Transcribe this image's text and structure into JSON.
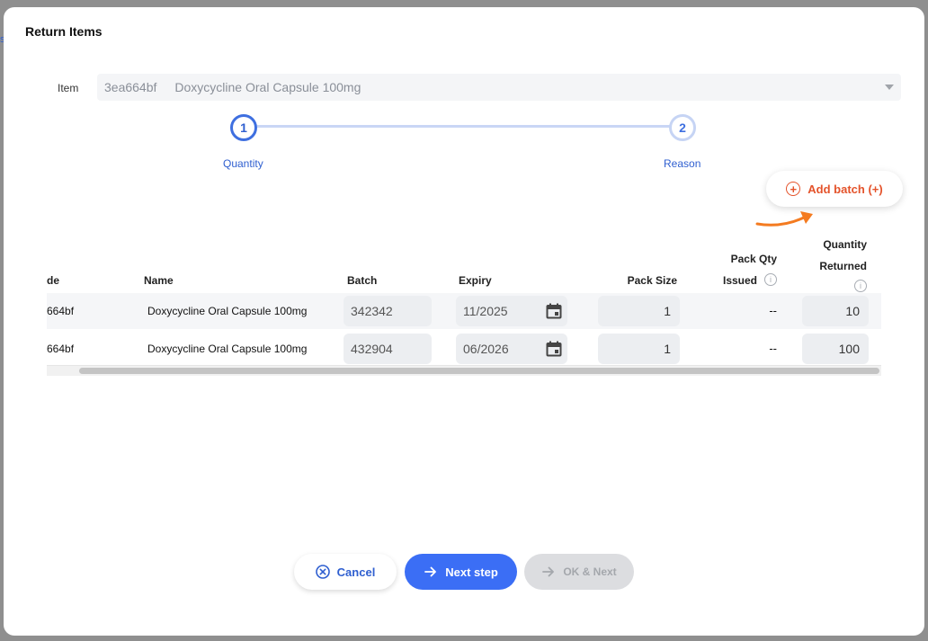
{
  "backdrop": {
    "hint_char": "s"
  },
  "modal": {
    "title": "Return Items"
  },
  "item_field": {
    "label": "Item",
    "code": "3ea664bf",
    "name": "Doxycycline Oral Capsule 100mg"
  },
  "stepper": {
    "steps": [
      {
        "number": "1",
        "label": "Quantity"
      },
      {
        "number": "2",
        "label": "Reason"
      }
    ]
  },
  "add_batch": {
    "label": "Add batch (+)"
  },
  "table": {
    "headers": {
      "code": "de",
      "name": "Name",
      "batch": "Batch",
      "expiry": "Expiry",
      "pack_size": "Pack Size",
      "pack_qty_line1": "Pack Qty",
      "pack_qty_line2": "Issued",
      "qty_line1": "Quantity",
      "qty_line2": "Returned",
      "info_glyph": "i"
    },
    "rows": [
      {
        "code": "664bf",
        "name": "Doxycycline Oral Capsule 100mg",
        "batch": "342342",
        "expiry": "11/2025",
        "pack_size": "1",
        "pack_qty_issued": "--",
        "quantity_returned": "10"
      },
      {
        "code": "664bf",
        "name": "Doxycycline Oral Capsule 100mg",
        "batch": "432904",
        "expiry": "06/2026",
        "pack_size": "1",
        "pack_qty_issued": "--",
        "quantity_returned": "100"
      }
    ]
  },
  "footer": {
    "cancel_label": "Cancel",
    "next_label": "Next step",
    "ok_next_label": "OK & Next"
  },
  "colors": {
    "accent": "#3b6ef5",
    "step_blue": "#3e6fe0",
    "add_batch_orange": "#e4532b",
    "arrow_orange": "#f47b20",
    "disabled_bg": "#dcdde0"
  },
  "icons": {
    "plus": "plus-circle-icon",
    "info": "info-icon",
    "calendar": "calendar-icon",
    "cancel": "close-circle-icon",
    "arrow": "arrow-right-icon",
    "dropdown": "chevron-down-icon"
  }
}
